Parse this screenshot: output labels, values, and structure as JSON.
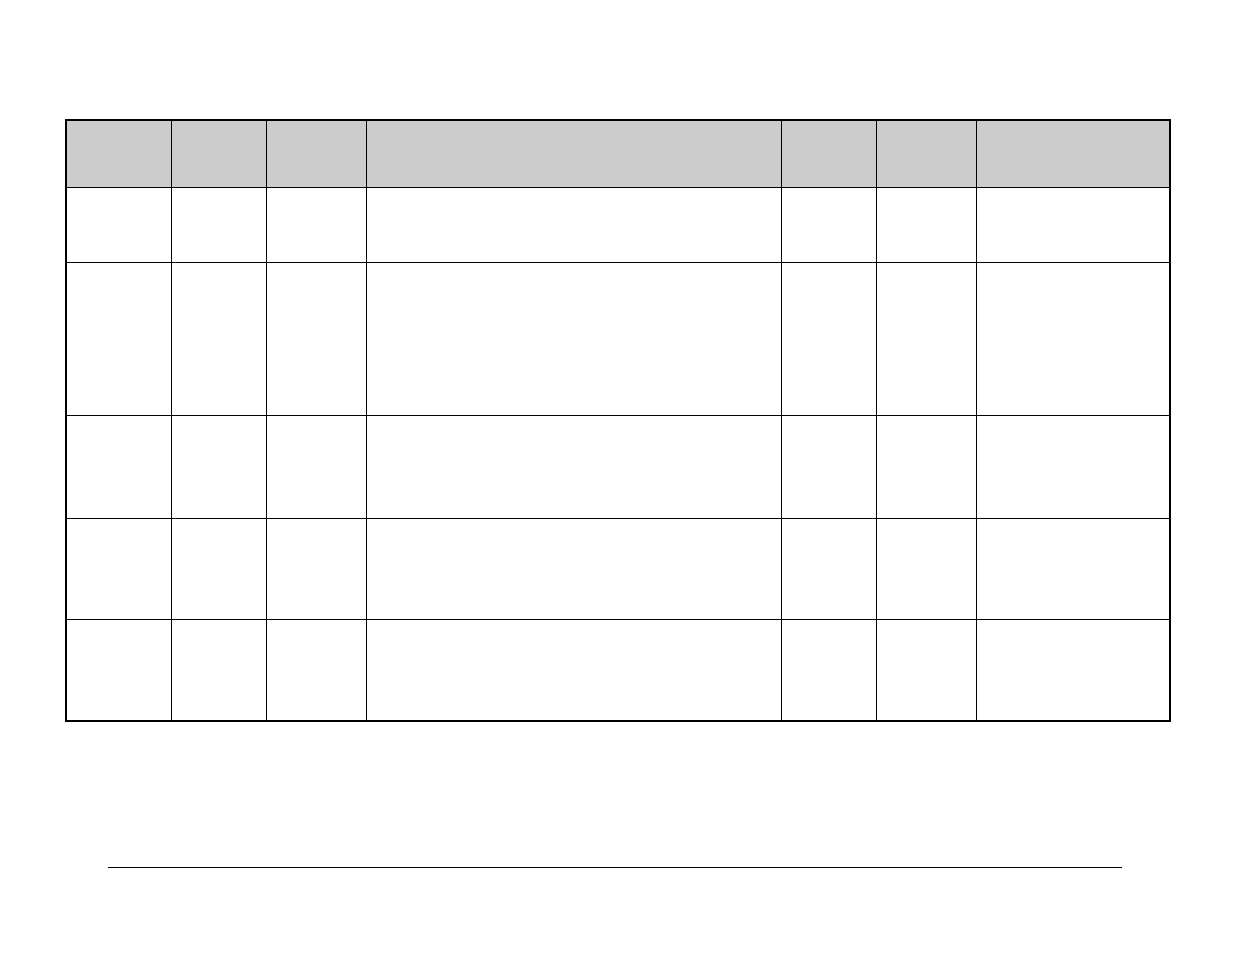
{
  "table": {
    "headers": [
      "",
      "",
      "",
      "",
      "",
      "",
      ""
    ],
    "rows": [
      [
        "",
        "",
        "",
        "",
        "",
        "",
        ""
      ],
      [
        "",
        "",
        "",
        "",
        "",
        "",
        ""
      ],
      [
        "",
        "",
        "",
        "",
        "",
        "",
        ""
      ],
      [
        "",
        "",
        "",
        "",
        "",
        "",
        ""
      ],
      [
        "",
        "",
        "",
        "",
        "",
        "",
        ""
      ]
    ]
  }
}
